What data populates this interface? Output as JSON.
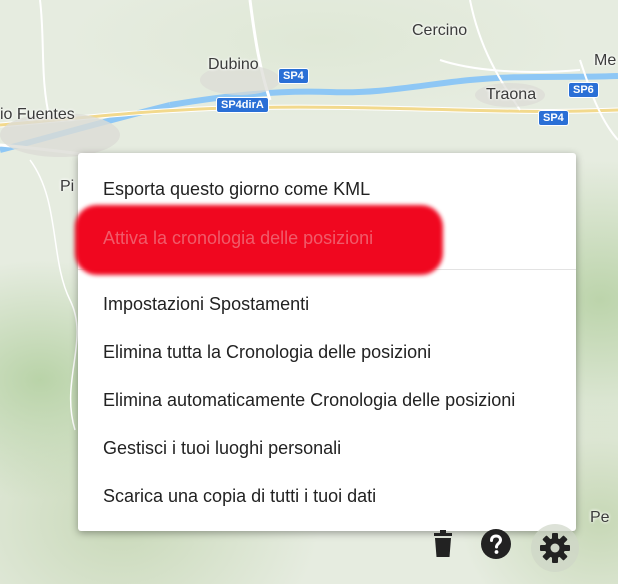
{
  "map": {
    "places": [
      {
        "id": "cercino",
        "label": "Cercino"
      },
      {
        "id": "dubino",
        "label": "Dubino"
      },
      {
        "id": "traona",
        "label": "Traona"
      },
      {
        "id": "fuentes",
        "label": "io Fuentes"
      },
      {
        "id": "me",
        "label": "Me"
      },
      {
        "id": "pi",
        "label": "Pi"
      },
      {
        "id": "pe",
        "label": "Pe"
      }
    ],
    "road_shields": [
      {
        "id": "sp4-a",
        "label": "SP4"
      },
      {
        "id": "sp4dira",
        "label": "SP4dirA"
      },
      {
        "id": "sp6",
        "label": "SP6"
      },
      {
        "id": "sp4-b",
        "label": "SP4"
      }
    ]
  },
  "menu": {
    "items": [
      {
        "id": "export-kml",
        "label": "Esporta questo giorno come KML"
      },
      {
        "id": "activate-history",
        "label": "Attiva la cronologia delle posizioni"
      },
      {
        "id": "timeline-settings",
        "label": "Impostazioni Spostamenti"
      },
      {
        "id": "delete-all-history",
        "label": "Elimina tutta la Cronologia delle posizioni"
      },
      {
        "id": "auto-delete-history",
        "label": "Elimina automaticamente Cronologia delle posizioni"
      },
      {
        "id": "manage-places",
        "label": "Gestisci i tuoi luoghi personali"
      },
      {
        "id": "download-data",
        "label": "Scarica una copia di tutti i tuoi dati"
      }
    ]
  },
  "toolbar": {
    "trash_icon": "trash-icon",
    "help_icon": "help-icon",
    "settings_icon": "gear-icon"
  },
  "colors": {
    "highlight": "#f00018",
    "river": "#8ec7f5",
    "shield": "#2a6fd6"
  }
}
